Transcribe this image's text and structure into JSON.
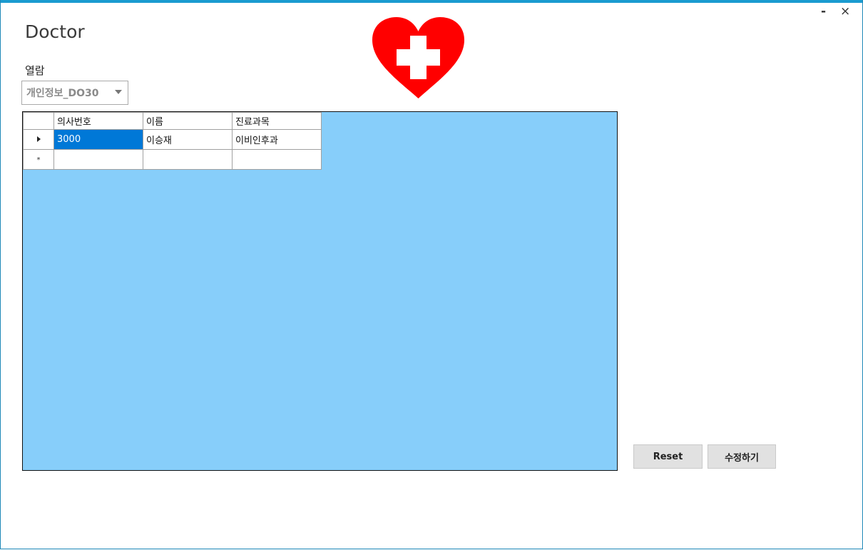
{
  "window": {
    "title": "Doctor",
    "minimize_label": "-",
    "close_label": "×"
  },
  "colors": {
    "accent": "#1a9bd0",
    "grid_background": "#87cefa",
    "selection": "#0078d7",
    "heart": "#ff0000"
  },
  "browse": {
    "label": "열람",
    "combo_value": "개인정보_DO30"
  },
  "grid": {
    "columns": [
      "의사번호",
      "이름",
      "진료과목"
    ],
    "rows": [
      {
        "indicator": "current-row-arrow",
        "cells": [
          "3000",
          "이승재",
          "이비인후과"
        ]
      }
    ],
    "new_row_indicator": "*"
  },
  "buttons": {
    "reset_label": "Reset",
    "edit_label": "수정하기"
  },
  "icons": {
    "logo": "heart-cross-icon"
  }
}
